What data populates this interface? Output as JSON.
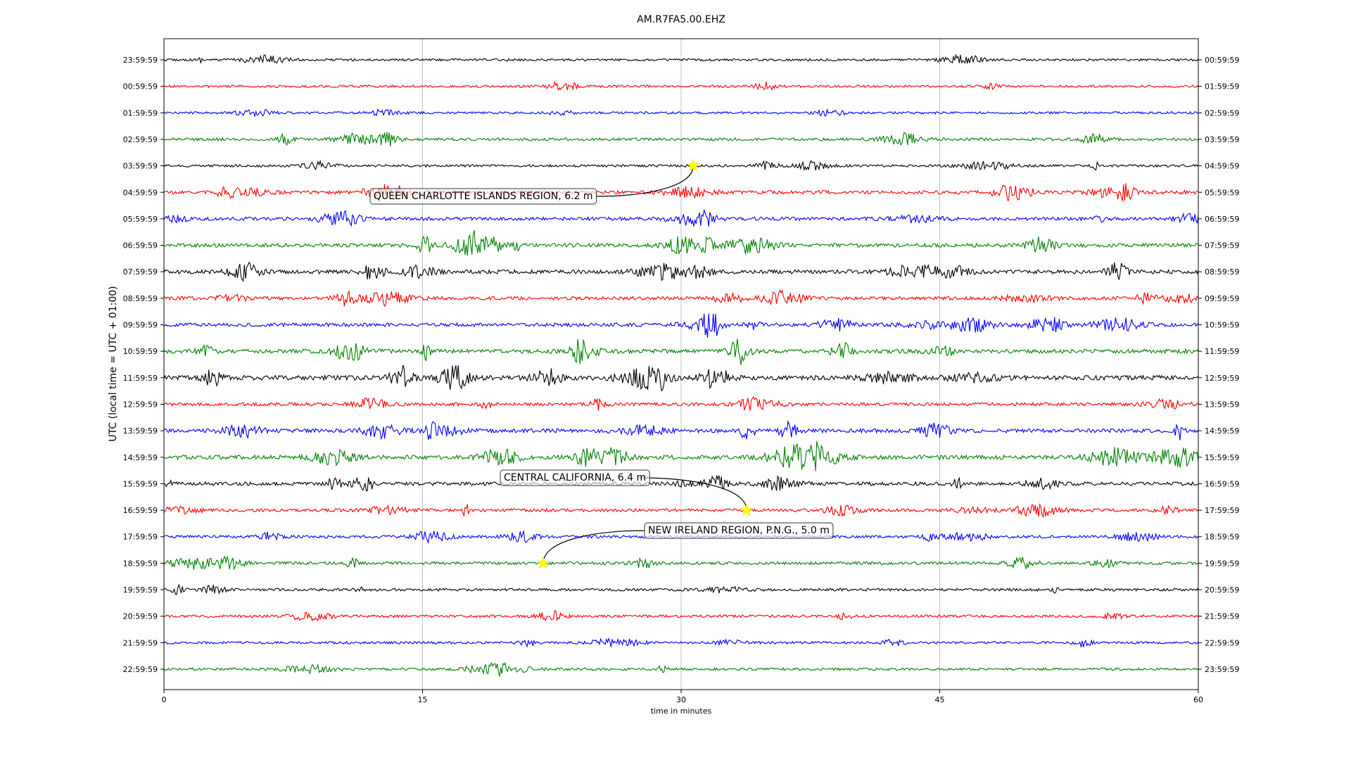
{
  "chart_data": {
    "type": "line",
    "title": "AM.R7FA5.00.EHZ",
    "xlabel": "time in minutes",
    "ylabel": "UTC (local time = UTC + 01:00)",
    "xlim": [
      0,
      60
    ],
    "xticks": [
      "0",
      "15",
      "30",
      "45",
      "60"
    ],
    "grid": "vertical lines at 15, 30, 45",
    "left_labels": [
      "23:59:59",
      "00:59:59",
      "01:59:59",
      "02:59:59",
      "03:59:59",
      "04:59:59",
      "05:59:59",
      "06:59:59",
      "07:59:59",
      "08:59:59",
      "09:59:59",
      "10:59:59",
      "11:59:59",
      "12:59:59",
      "13:59:59",
      "14:59:59",
      "15:59:59",
      "16:59:59",
      "17:59:59",
      "18:59:59",
      "19:59:59",
      "20:59:59",
      "21:59:59",
      "22:59:59"
    ],
    "right_labels": [
      "00:59:59",
      "01:59:59",
      "02:59:59",
      "03:59:59",
      "04:59:59",
      "05:59:59",
      "06:59:59",
      "07:59:59",
      "08:59:59",
      "09:59:59",
      "10:59:59",
      "11:59:59",
      "12:59:59",
      "13:59:59",
      "14:59:59",
      "15:59:59",
      "16:59:59",
      "17:59:59",
      "18:59:59",
      "19:59:59",
      "20:59:59",
      "21:59:59",
      "22:59:59",
      "23:59:59"
    ],
    "trace_colors": [
      "#000000",
      "#ff0000",
      "#0000ff",
      "#008000"
    ],
    "activity": [
      0.2,
      0.2,
      0.2,
      0.35,
      0.25,
      0.6,
      0.55,
      0.65,
      0.7,
      0.55,
      0.6,
      0.75,
      0.95,
      0.5,
      0.7,
      0.8,
      0.6,
      0.45,
      0.35,
      0.4,
      0.3,
      0.3,
      0.25,
      0.25
    ],
    "events": [
      {
        "label": "QUEEN CHARLOTTE ISLANDS REGION, 6.2 m",
        "row": 4,
        "minute": 30.7
      },
      {
        "label": "CENTRAL CALIFORNIA, 6.4 m",
        "row": 17,
        "minute": 33.8
      },
      {
        "label": "NEW IRELAND REGION, P.N.G., 5.0 m",
        "row": 19,
        "minute": 22.0
      }
    ]
  }
}
